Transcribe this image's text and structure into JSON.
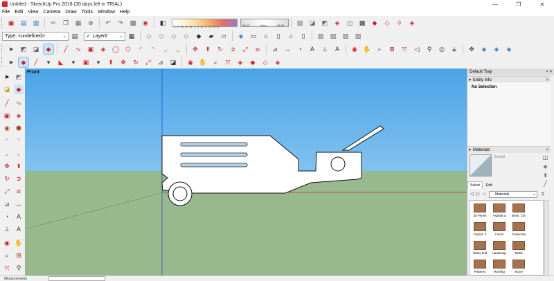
{
  "window": {
    "title": "Untitled - SketchUp Pro 2018 (30 days left in TRIAL)",
    "minimize": "—",
    "maximize": "❐",
    "close": "✕"
  },
  "menu": [
    "File",
    "Edit",
    "View",
    "Camera",
    "Draw",
    "Tools",
    "Window",
    "Help"
  ],
  "shadow": {
    "months": "J F M A M J J A S O N D",
    "time_start": "06:43",
    "time_mid": "Noon",
    "time_end": "04:46"
  },
  "style_dropdown": {
    "value": "Type: <undefined>"
  },
  "layer_dropdown": {
    "check": "✓",
    "value": "Layer0"
  },
  "viewport": {
    "view_label": "Front"
  },
  "tray": {
    "title": "Default Tray",
    "controls": "▪ ✕",
    "entity_info": {
      "header": "Entity Info",
      "status": "No Selection"
    },
    "materials": {
      "header": "Materials",
      "current": "Default",
      "tabs": [
        "Select",
        "Edit"
      ],
      "library": "Materials",
      "items": [
        "3d Printin",
        "Asphalt a",
        "Brick, Cla",
        "Carpet, F",
        "Colors",
        "Colors-Ne",
        "Glass and",
        "Landscap",
        "Metal",
        "Patterns",
        "Roofing",
        "Stone"
      ]
    }
  },
  "status": {
    "measurements_label": "Measurements"
  }
}
